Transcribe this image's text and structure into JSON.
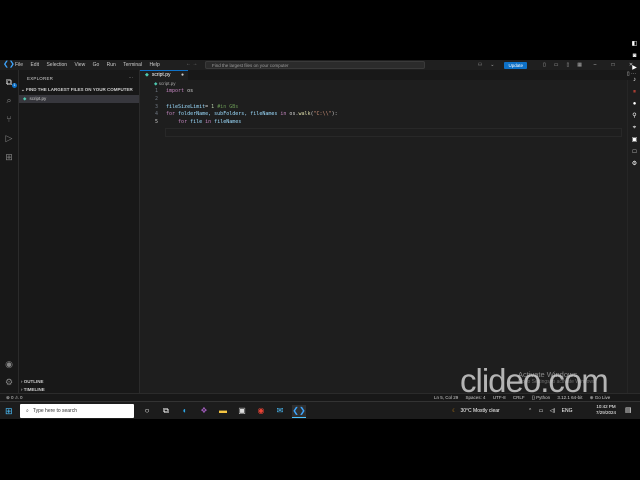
{
  "titlebar": {
    "menu": [
      "File",
      "Edit",
      "Selection",
      "View",
      "Go",
      "Run",
      "Terminal",
      "Help"
    ],
    "search_text": "Find the largest files on your computer",
    "update_label": "Update"
  },
  "sidebar": {
    "explorer_label": "EXPLORER",
    "folder_label": "FIND THE LARGEST FILES ON YOUR COMPUTER",
    "file_label": "script.py",
    "outline_label": "OUTLINE",
    "timeline_label": "TIMELINE"
  },
  "editor": {
    "tab_label": "script.py",
    "breadcrumb": "script.py",
    "lines": [
      {
        "n": "1",
        "tokens": [
          {
            "t": "import",
            "c": "kw"
          },
          {
            "t": " os",
            "c": "plain"
          }
        ]
      },
      {
        "n": "2",
        "tokens": []
      },
      {
        "n": "3",
        "tokens": [
          {
            "t": "fileSizeLimit",
            "c": "var"
          },
          {
            "t": "= ",
            "c": "plain"
          },
          {
            "t": "1",
            "c": "num"
          },
          {
            "t": " #in GBs",
            "c": "cmt"
          }
        ]
      },
      {
        "n": "4",
        "tokens": [
          {
            "t": "for",
            "c": "kw"
          },
          {
            "t": " folderName, subFolders, fileNames ",
            "c": "var"
          },
          {
            "t": "in",
            "c": "kw"
          },
          {
            "t": " os.",
            "c": "plain"
          },
          {
            "t": "walk",
            "c": "fn"
          },
          {
            "t": "(",
            "c": "plain"
          },
          {
            "t": "\"C:\\\\\"",
            "c": "str"
          },
          {
            "t": "):",
            "c": "plain"
          }
        ]
      },
      {
        "n": "5",
        "tokens": [
          {
            "t": "    ",
            "c": "plain"
          },
          {
            "t": "for",
            "c": "kw"
          },
          {
            "t": " file ",
            "c": "var"
          },
          {
            "t": "in",
            "c": "kw"
          },
          {
            "t": " fileNames",
            "c": "var"
          }
        ]
      }
    ]
  },
  "statusbar": {
    "left": "⊗ 0 ⚠ 0",
    "right": [
      "Ln 5, Col 29",
      "Spaces: 4",
      "UTF-8",
      "CRLF",
      "{} Python",
      "3.12.1 64-bit",
      "⊕ Go Live"
    ]
  },
  "watermark": {
    "activate_title": "Activate Windows",
    "activate_sub": "Go to Settings to activate Windows.",
    "clideo": "clideo.com"
  },
  "taskbar": {
    "search_placeholder": "Type here to search",
    "weather_temp": "30°C",
    "weather_text": "Mostly clear",
    "lang": "ENG",
    "time": "10:42 PM",
    "date": "7/29/2024"
  }
}
